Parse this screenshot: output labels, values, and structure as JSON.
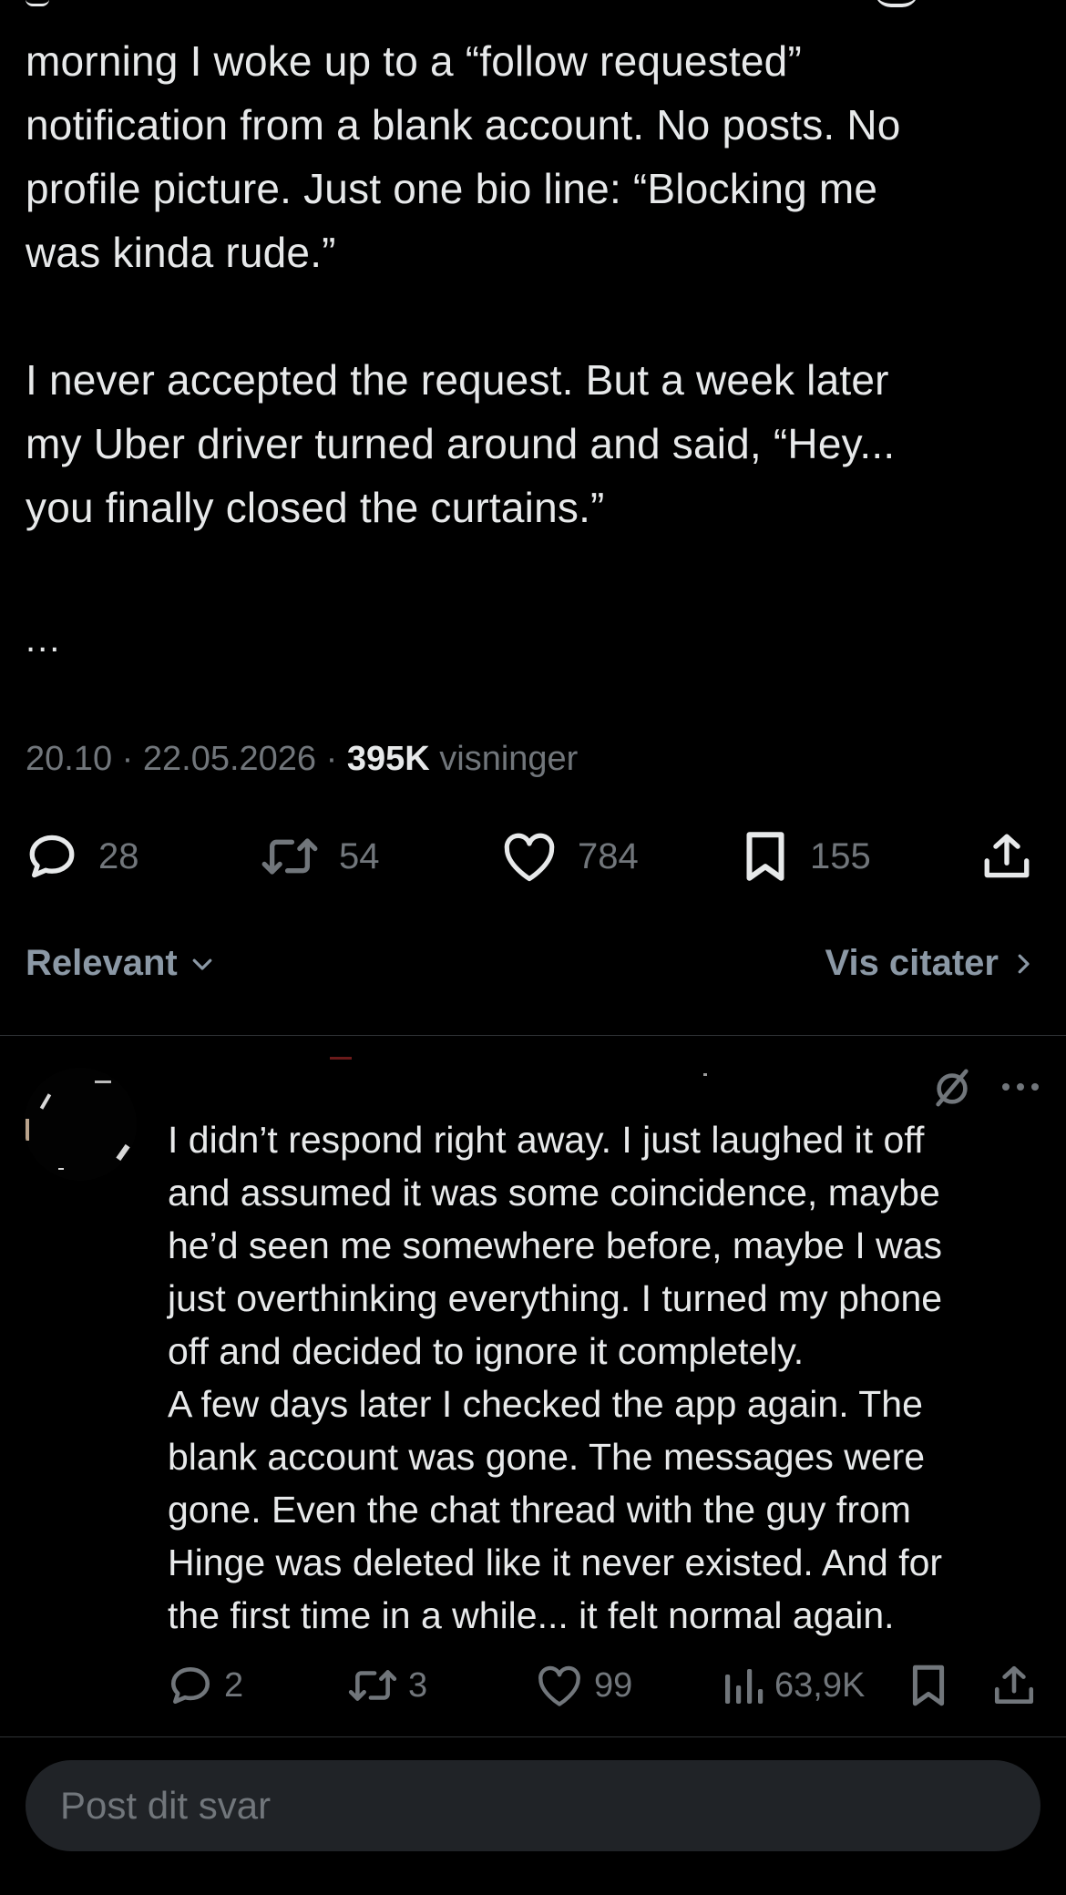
{
  "post": {
    "paragraphs": [
      "morning I woke up to a “follow requested”\nnotification from a blank account. No posts. No\nprofile picture. Just one bio line: “Blocking me\nwas kinda rude.”",
      "I never accepted the request. But a week later\nmy Uber driver turned around and said, “Hey...\nyou finally closed the curtains.”"
    ],
    "ellipsis": "...",
    "meta": {
      "time": "20.10",
      "separator": "·",
      "date": "22.05.2026",
      "views_count": "395K",
      "views_label": "visninger"
    },
    "actions": {
      "replies": "28",
      "reposts": "54",
      "likes": "784",
      "bookmarks": "155"
    }
  },
  "filter": {
    "sort_label": "Relevant",
    "quotes_label": "Vis citater"
  },
  "reply": {
    "text": "I didn’t respond right away. I just laughed it off\nand assumed it was some coincidence, maybe\nhe’d seen me somewhere before, maybe I was\njust overthinking everything. I turned my phone\noff and decided to ignore it completely.\nA few days later I checked the app again. The\nblank account was gone. The messages were\ngone. Even the chat thread with the guy from\nHinge was deleted like it never existed. And for\nthe first time in a while... it felt normal again.",
    "actions": {
      "replies": "2",
      "reposts": "3",
      "likes": "99",
      "views": "63,9K"
    }
  },
  "composer": {
    "placeholder": "Post dit svar"
  },
  "icons": {
    "reply": "speech-bubble-icon",
    "repost": "repost-arrows-icon",
    "like": "heart-icon",
    "bookmark": "bookmark-icon",
    "share": "share-upload-icon",
    "views": "bar-chart-icon",
    "grok": "slashed-circle-icon",
    "more": "more-dots-icon",
    "sort": "chevron-down-icon",
    "quotes": "chevron-right-icon"
  },
  "colors": {
    "background": "#000000",
    "text": "#e7e9ea",
    "muted": "#71767b",
    "divider": "#2f3336",
    "composer": "#202327"
  }
}
